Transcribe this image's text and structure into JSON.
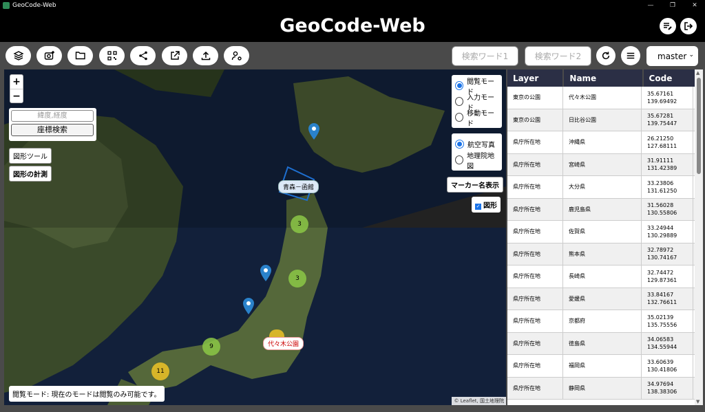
{
  "window": {
    "title": "GeoCode-Web"
  },
  "header": {
    "title": "GeoCode-Web"
  },
  "toolbar": {
    "search1_placeholder": "検索ワード1",
    "search2_placeholder": "検索ワード2",
    "branch_selected": "master"
  },
  "map": {
    "zoom_in": "+",
    "zoom_out": "−",
    "coord_placeholder": "緯度,経度",
    "coord_search": "座標検索",
    "shape_tools": "図形ツール",
    "shape_measure": "図形の計測",
    "modes": [
      {
        "label": "閲覧モード",
        "selected": true
      },
      {
        "label": "入力モード",
        "selected": false
      },
      {
        "label": "移動モード",
        "selected": false
      }
    ],
    "basemaps": [
      {
        "label": "航空写真",
        "selected": true
      },
      {
        "label": "地理院地図",
        "selected": false
      }
    ],
    "marker_names": "マーカー名表示",
    "shape_toggle": "図形",
    "polygon_label": "青森－函館",
    "marker_label": "代々木公園",
    "clusters": [
      "3",
      "3",
      "9",
      "11"
    ],
    "status": "閲覧モード: 現在のモードは閲覧のみ可能です。",
    "attribution": "© Leaflet, 国土地理院"
  },
  "table": {
    "headers": [
      "Layer",
      "Name",
      "Code"
    ],
    "rows": [
      {
        "layer": "東京の公園",
        "name": "代々木公園",
        "lat": "35.67161",
        "lng": "139.69492"
      },
      {
        "layer": "東京の公園",
        "name": "日比谷公園",
        "lat": "35.67281",
        "lng": "139.75447"
      },
      {
        "layer": "県庁所在地",
        "name": "沖縄県",
        "lat": "26.21250",
        "lng": "127.68111"
      },
      {
        "layer": "県庁所在地",
        "name": "宮崎県",
        "lat": "31.91111",
        "lng": "131.42389"
      },
      {
        "layer": "県庁所在地",
        "name": "大分県",
        "lat": "33.23806",
        "lng": "131.61250"
      },
      {
        "layer": "県庁所在地",
        "name": "鹿児島県",
        "lat": "31.56028",
        "lng": "130.55806"
      },
      {
        "layer": "県庁所在地",
        "name": "佐賀県",
        "lat": "33.24944",
        "lng": "130.29889"
      },
      {
        "layer": "県庁所在地",
        "name": "熊本県",
        "lat": "32.78972",
        "lng": "130.74167"
      },
      {
        "layer": "県庁所在地",
        "name": "長崎県",
        "lat": "32.74472",
        "lng": "129.87361"
      },
      {
        "layer": "県庁所在地",
        "name": "愛媛県",
        "lat": "33.84167",
        "lng": "132.76611"
      },
      {
        "layer": "県庁所在地",
        "name": "京都府",
        "lat": "35.02139",
        "lng": "135.75556"
      },
      {
        "layer": "県庁所在地",
        "name": "徳島県",
        "lat": "34.06583",
        "lng": "134.55944"
      },
      {
        "layer": "県庁所在地",
        "name": "福岡県",
        "lat": "33.60639",
        "lng": "130.41806"
      },
      {
        "layer": "県庁所在地",
        "name": "静岡県",
        "lat": "34.97694",
        "lng": "138.38306"
      }
    ]
  },
  "colors": {
    "header_bg": "#000000",
    "table_header_bg": "#2b2f45",
    "accent": "#1a73e8"
  }
}
